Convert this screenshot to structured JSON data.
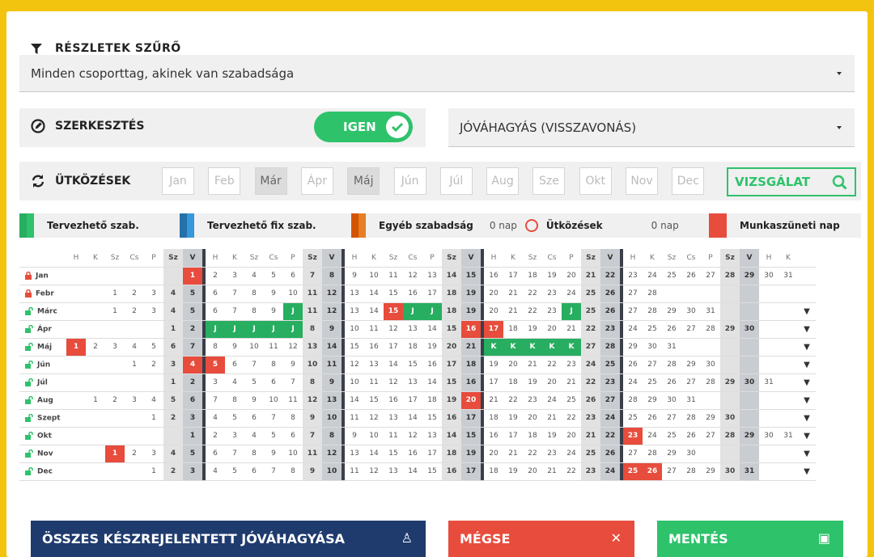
{
  "filter": {
    "title": "RÉSZLETEK SZŰRŐ",
    "select_value": "Minden csoporttag, akinek van szabadsága"
  },
  "edit": {
    "label": "SZERKESZTÉS",
    "toggle_label": "IGEN",
    "toggle_on": true,
    "action_select": "JÓVÁHAGYÁS (VISSZAVONÁS)"
  },
  "conflicts": {
    "label": "ÜTKÖZÉSEK",
    "months": [
      "Jan",
      "Feb",
      "Már",
      "Ápr",
      "Máj",
      "Jún",
      "Júl",
      "Aug",
      "Sze",
      "Okt",
      "Nov",
      "Dec"
    ],
    "active_months": [
      2,
      4
    ],
    "check_button": "VIZSGÁLAT"
  },
  "legend": {
    "planned": "Tervezhető szab.",
    "planned_fixed": "Tervezhető fix szab.",
    "other": "Egyéb szabadság",
    "other_days": "0 nap",
    "conflicts": "Ütközések",
    "conflicts_days": "0 nap",
    "holiday": "Munkaszüneti nap"
  },
  "colors": {
    "green": "#2ec26b",
    "dark_green": "#27ae60",
    "blue": "#2a86c8",
    "orange": "#e67e22",
    "red": "#e74c3c",
    "navy": "#1f3b6e"
  },
  "calendar": {
    "day_headers": [
      "H",
      "K",
      "Sz",
      "Cs",
      "P",
      "Sz",
      "V",
      "H",
      "K",
      "Sz",
      "Cs",
      "P",
      "Sz",
      "V",
      "H",
      "K",
      "Sz",
      "Cs",
      "P",
      "Sz",
      "V",
      "H",
      "K",
      "Sz",
      "Cs",
      "P",
      "Sz",
      "V",
      "H",
      "K",
      "Sz",
      "Cs",
      "P",
      "Sz",
      "V",
      "H",
      "K"
    ],
    "months": [
      {
        "name": "Jan",
        "locked": true,
        "offset": 6,
        "days": 31,
        "holidays": [
          1
        ],
        "planned": [],
        "arrow": false
      },
      {
        "name": "Febr",
        "locked": true,
        "offset": 2,
        "days": 28,
        "holidays": [],
        "planned": [],
        "arrow": false
      },
      {
        "name": "Márc",
        "locked": false,
        "offset": 2,
        "days": 31,
        "holidays": [
          15
        ],
        "planned": [
          10,
          16,
          17,
          24
        ],
        "arrow": true
      },
      {
        "name": "Ápr",
        "locked": false,
        "offset": 5,
        "days": 30,
        "holidays": [
          16,
          17
        ],
        "planned": [
          3,
          4,
          5,
          6,
          7
        ],
        "arrow": true
      },
      {
        "name": "Máj",
        "locked": false,
        "offset": 0,
        "days": 31,
        "holidays": [
          1
        ],
        "planned": [
          22,
          23,
          24,
          25,
          26
        ],
        "arrow": true
      },
      {
        "name": "Jún",
        "locked": false,
        "offset": 3,
        "days": 30,
        "holidays": [
          4,
          5
        ],
        "planned": [],
        "arrow": true
      },
      {
        "name": "Júl",
        "locked": false,
        "offset": 5,
        "days": 31,
        "holidays": [],
        "planned": [],
        "arrow": true
      },
      {
        "name": "Aug",
        "locked": false,
        "offset": 1,
        "days": 31,
        "holidays": [
          20
        ],
        "planned": [],
        "arrow": true
      },
      {
        "name": "Szept",
        "locked": false,
        "offset": 4,
        "days": 30,
        "holidays": [],
        "planned": [],
        "arrow": true
      },
      {
        "name": "Okt",
        "locked": false,
        "offset": 6,
        "days": 31,
        "holidays": [
          23
        ],
        "planned": [],
        "arrow": true
      },
      {
        "name": "Nov",
        "locked": false,
        "offset": 2,
        "days": 30,
        "holidays": [
          1
        ],
        "planned": [],
        "arrow": true
      },
      {
        "name": "Dec",
        "locked": false,
        "offset": 4,
        "days": 31,
        "holidays": [
          25,
          26
        ],
        "planned": [],
        "arrow": true
      }
    ]
  },
  "buttons": {
    "approve_all": "ÖSSZES KÉSZREJELENTETT JÓVÁHAGYÁSA",
    "cancel": "MÉGSE",
    "save": "MENTÉS"
  }
}
